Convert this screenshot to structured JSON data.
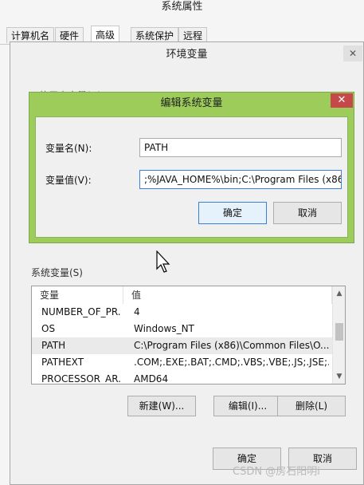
{
  "system_properties": {
    "title": "系统属性",
    "tabs": [
      "计算机名",
      "硬件",
      "高级",
      "系统保护",
      "远程"
    ]
  },
  "env_dialog": {
    "title": "环境变量",
    "close_glyph": "✕",
    "user_vars_label": "         的用户变量(U)",
    "system_vars_label": "系统变量(S)",
    "columns": {
      "var": "变量",
      "val": "值"
    },
    "rows": [
      {
        "var": "NUMBER_OF_PR...",
        "val": "4"
      },
      {
        "var": "OS",
        "val": "Windows_NT"
      },
      {
        "var": "PATH",
        "val": "C:\\Program Files (x86)\\Common Files\\O..."
      },
      {
        "var": "PATHEXT",
        "val": ".COM;.EXE;.BAT;.CMD;.VBS;.VBE;.JS;.JSE;..."
      },
      {
        "var": "PROCESSOR_AR...",
        "val": "AMD64"
      }
    ],
    "selected_row": "PATH",
    "scroll_up_glyph": "▲",
    "scroll_down_glyph": "▼",
    "buttons": {
      "new": "新建(W)...",
      "edit": "编辑(I)...",
      "delete": "删除(L)",
      "ok": "确定",
      "cancel": "取消"
    }
  },
  "edit_dialog": {
    "title": "编辑系统变量",
    "close_glyph": "✕",
    "name_label": "变量名(N):",
    "name_value": "PATH",
    "value_label": "变量值(V):",
    "value_value": ";%JAVA_HOME%\\bin;C:\\Program Files (x86",
    "ok": "确定",
    "cancel": "取消",
    "accent": "#9dcc5a"
  },
  "watermark": "CSDN @房石阳明i",
  "icons": {
    "cursor": "mouse-pointer-icon"
  }
}
